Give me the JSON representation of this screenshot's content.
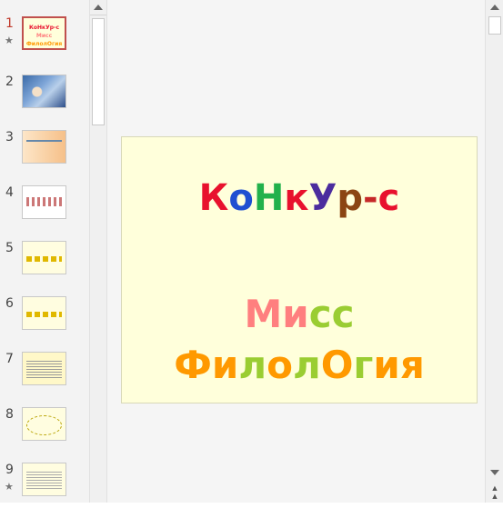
{
  "thumbnails": [
    {
      "number": "1",
      "has_transition": true,
      "selected": true,
      "mini_lines": [
        "КоНкУр-с",
        "Мисс",
        "ФилолОгия"
      ]
    },
    {
      "number": "2",
      "has_transition": false,
      "selected": false
    },
    {
      "number": "3",
      "has_transition": false,
      "selected": false
    },
    {
      "number": "4",
      "has_transition": false,
      "selected": false
    },
    {
      "number": "5",
      "has_transition": false,
      "selected": false
    },
    {
      "number": "6",
      "has_transition": false,
      "selected": false
    },
    {
      "number": "7",
      "has_transition": false,
      "selected": false
    },
    {
      "number": "8",
      "has_transition": false,
      "selected": false
    },
    {
      "number": "9",
      "has_transition": true,
      "selected": false
    }
  ],
  "star_glyph": "★",
  "slide": {
    "background": "#ffffdb",
    "title_line1": [
      {
        "t": "К",
        "c": "#e8112d"
      },
      {
        "t": "о",
        "c": "#1f4fd1"
      },
      {
        "t": "Н",
        "c": "#22b14c"
      },
      {
        "t": "к",
        "c": "#e8112d"
      },
      {
        "t": "У",
        "c": "#4b2c9e"
      },
      {
        "t": "р",
        "c": "#8b4513"
      },
      {
        "t": "-",
        "c": "#c62828"
      },
      {
        "t": "с",
        "c": "#e8112d"
      }
    ],
    "title_line2": [
      {
        "t": "М",
        "c": "#ff7f7f"
      },
      {
        "t": "и",
        "c": "#ff7f7f"
      },
      {
        "t": "с",
        "c": "#9acd32"
      },
      {
        "t": "с",
        "c": "#9acd32"
      }
    ],
    "title_line3": [
      {
        "t": "Ф",
        "c": "#ff9900"
      },
      {
        "t": "и",
        "c": "#ff9900"
      },
      {
        "t": "л",
        "c": "#9acd32"
      },
      {
        "t": "о",
        "c": "#ff9900"
      },
      {
        "t": "л",
        "c": "#9acd32"
      },
      {
        "t": "О",
        "c": "#ff9900"
      },
      {
        "t": "г",
        "c": "#9acd32"
      },
      {
        "t": "и",
        "c": "#ff9900"
      },
      {
        "t": "я",
        "c": "#ff9900"
      }
    ]
  }
}
